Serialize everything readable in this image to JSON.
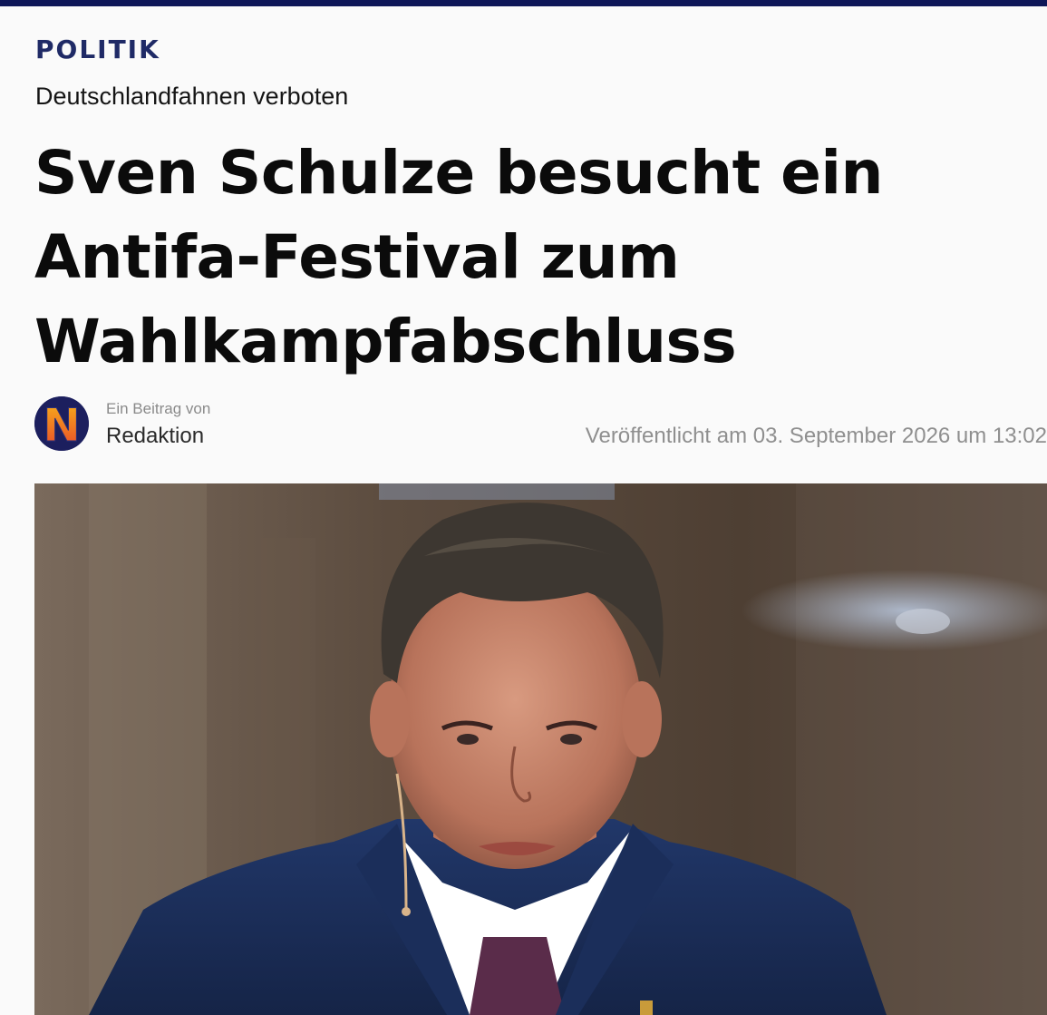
{
  "article": {
    "section": "POLITIK",
    "kicker": "Deutschlandfahnen verboten",
    "headline_lines": [
      "Sven Schulze besucht ein",
      "Antifa-Festival zum",
      "Wahlkampfabschluss"
    ],
    "byline": {
      "prefix": "Ein Beitrag von",
      "author": "Redaktion",
      "avatar_letter": "N"
    },
    "published": "Veröffentlicht am 03. September 2026 um 13:02"
  },
  "hero_image": {
    "subject": "photo of a man in a dark blue suit with a white shirt and purple tie"
  },
  "colors": {
    "accent": "#0e1658",
    "section": "#1f2a66",
    "logo_bg": "#1c1f5e",
    "logo_letter_top": "#f7b21a",
    "logo_letter_bottom": "#e8462a"
  }
}
